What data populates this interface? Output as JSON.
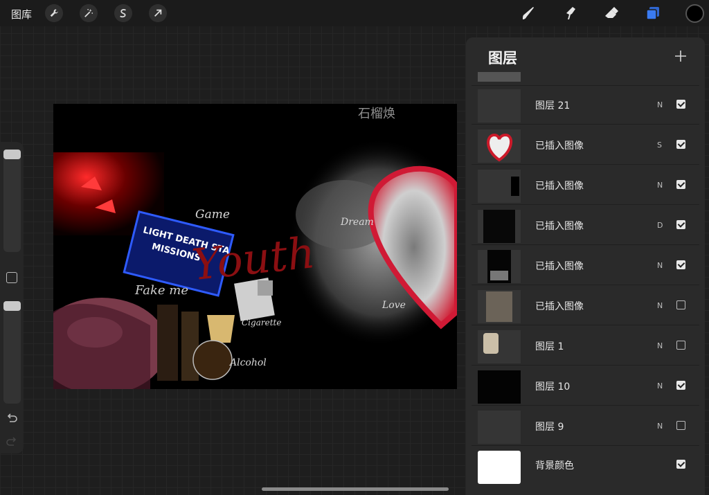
{
  "topbar": {
    "gallery_label": "图库",
    "left_tools": [
      "wrench-icon",
      "magic-wand-icon",
      "selection-icon",
      "transform-arrow-icon"
    ],
    "right_tools": [
      "brush-icon",
      "smudge-icon",
      "eraser-icon",
      "layers-icon"
    ],
    "active_color": "#000000",
    "accent": "#3a7bf2"
  },
  "canvas": {
    "texts": [
      "Game",
      "Youth",
      "Dream",
      "Fake me",
      "Cigarette",
      "Alcohol",
      "Love",
      "石榴焕",
      "LIGHT DEATH STA",
      "MISSIONS"
    ]
  },
  "layers_panel": {
    "title": "图层",
    "layers": [
      {
        "name": "图层 21",
        "blend": "N",
        "visible": true
      },
      {
        "name": "已插入图像",
        "blend": "S",
        "visible": true
      },
      {
        "name": "已插入图像",
        "blend": "N",
        "visible": true
      },
      {
        "name": "已插入图像",
        "blend": "D",
        "visible": true
      },
      {
        "name": "已插入图像",
        "blend": "N",
        "visible": true
      },
      {
        "name": "已插入图像",
        "blend": "N",
        "visible": false
      },
      {
        "name": "图层 1",
        "blend": "N",
        "visible": false
      },
      {
        "name": "图层 10",
        "blend": "N",
        "visible": true
      },
      {
        "name": "图层 9",
        "blend": "N",
        "visible": false
      },
      {
        "name": "背景颜色",
        "blend": "",
        "visible": true
      }
    ]
  }
}
